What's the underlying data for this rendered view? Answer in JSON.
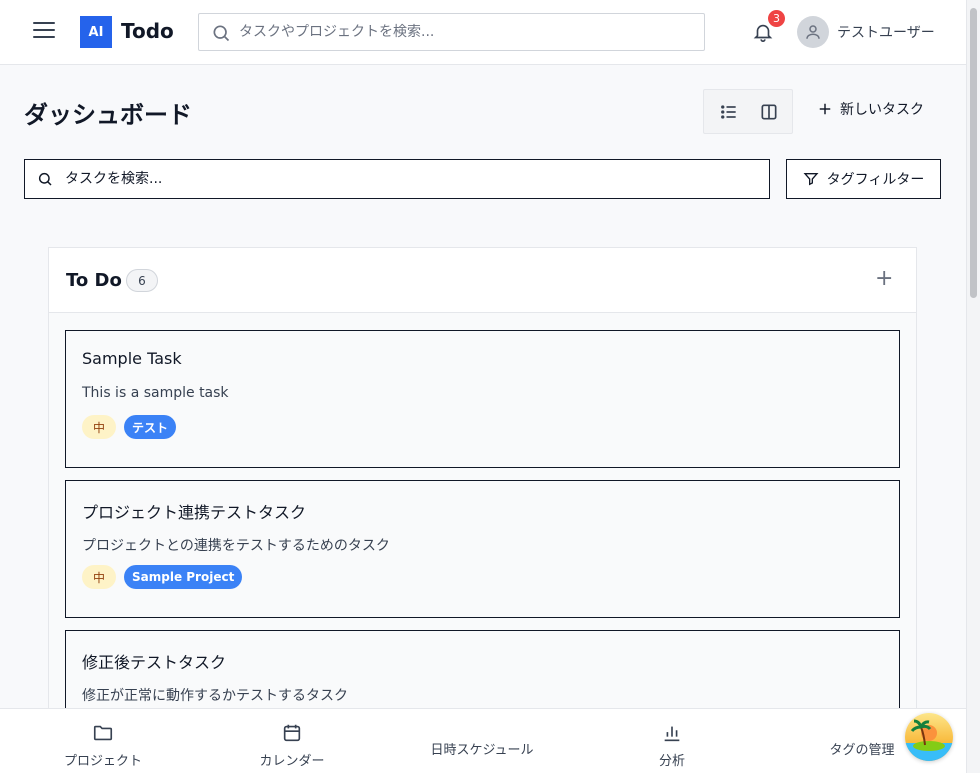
{
  "header": {
    "logo_badge": "AI",
    "logo_text": "Todo",
    "search_placeholder": "タスクやプロジェクトを検索...",
    "notification_count": "3",
    "user_name": "テストユーザー"
  },
  "page": {
    "title": "ダッシュボード",
    "new_task_label": "新しいタスク",
    "task_search_placeholder": "タスクを検索...",
    "tag_filter_label": "タグフィルター"
  },
  "column": {
    "title": "To Do",
    "count": "6",
    "add_icon": "+"
  },
  "tasks": [
    {
      "title": "Sample Task",
      "description": "This is a sample task",
      "priority": "中",
      "tag": "テスト"
    },
    {
      "title": "プロジェクト連携テストタスク",
      "description": "プロジェクトとの連携をテストするためのタスク",
      "priority": "中",
      "tag": "Sample Project"
    },
    {
      "title": "修正後テストタスク",
      "description": "修正が正常に動作するかテストするタスク"
    }
  ],
  "bottom_nav": [
    {
      "label": "プロジェクト",
      "icon": "folder-icon"
    },
    {
      "label": "カレンダー",
      "icon": "calendar-icon"
    },
    {
      "label": "日時スケジュール",
      "icon": ""
    },
    {
      "label": "分析",
      "icon": "bar-chart-icon"
    },
    {
      "label": "タグの管理",
      "icon": ""
    }
  ],
  "colors": {
    "accent": "#2563eb",
    "tag_blue": "#3b82f6",
    "priority_bg": "#fef3c7",
    "notification_red": "#ef4444"
  }
}
